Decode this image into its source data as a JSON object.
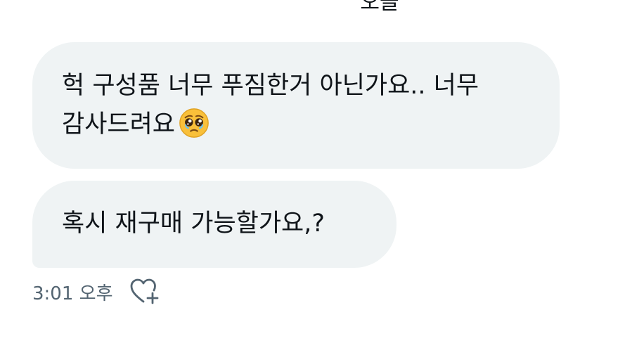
{
  "header": {
    "date_label": "오늘"
  },
  "messages": [
    {
      "lines": [
        "헉 구성품 너무 푸짐한거 아닌가요.. 너무",
        "감사드려요"
      ],
      "emoji": "pleading-face"
    },
    {
      "lines": [
        "혹시 재구매 가능할가요,?"
      ]
    }
  ],
  "meta": {
    "timestamp": "3:01 오후",
    "reaction_icon": "heart-plus-icon"
  },
  "colors": {
    "bubble_bg": "#eff3f4",
    "text": "#0f1419",
    "muted": "#536471"
  }
}
